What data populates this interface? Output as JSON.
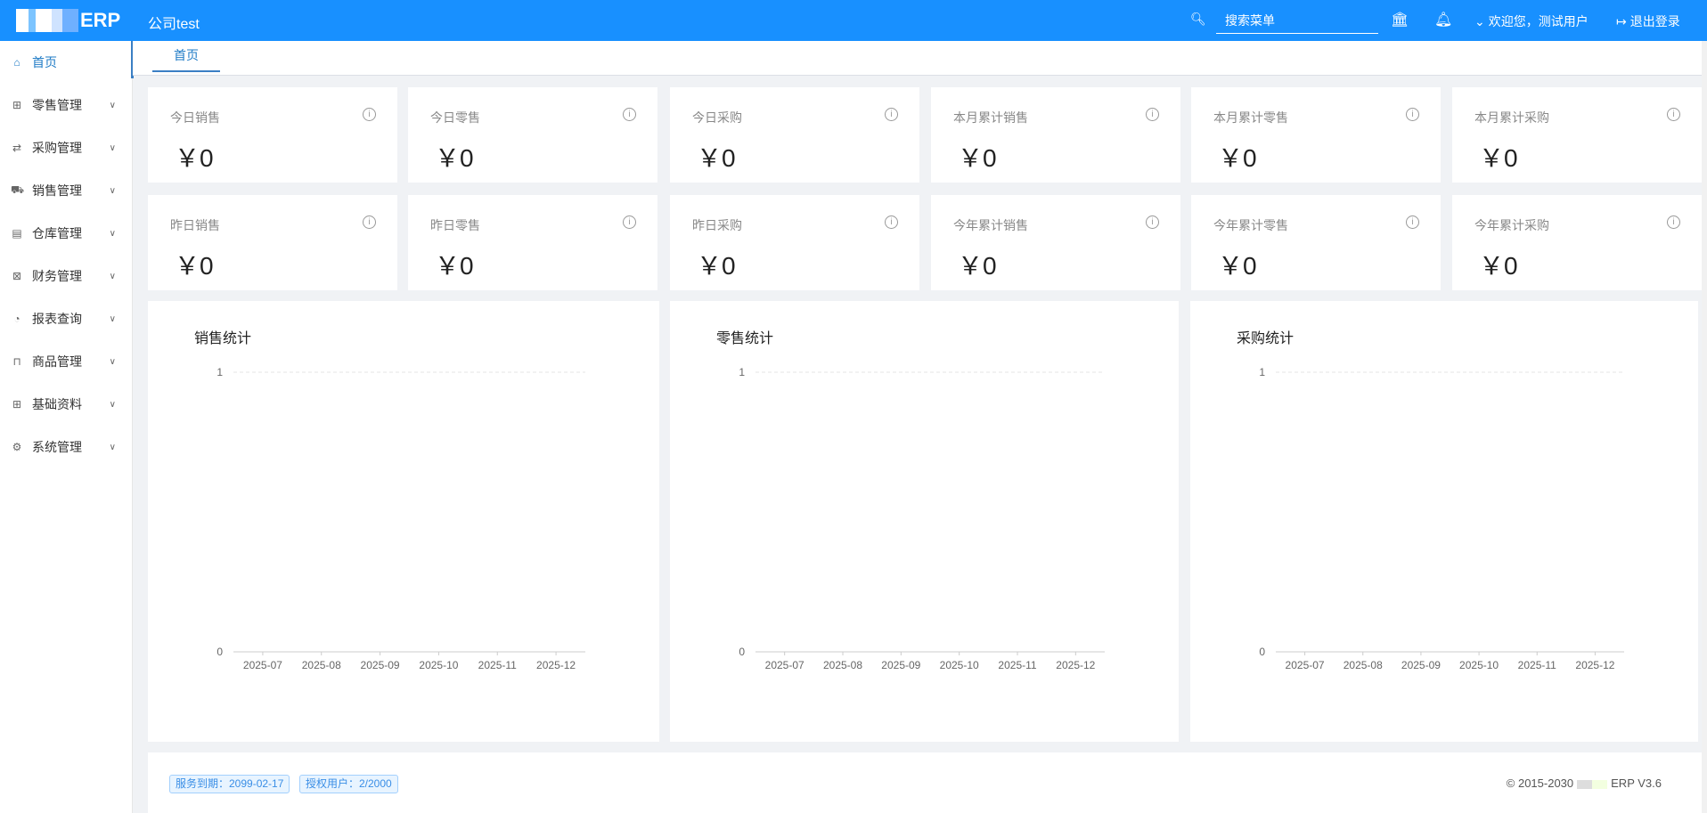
{
  "header": {
    "logo_text": "ERP",
    "company": "公司test",
    "search_placeholder": "搜索菜单",
    "welcome": "欢迎您，测试用户",
    "logout": "退出登录"
  },
  "sidebar": {
    "items": [
      {
        "label": "首页",
        "icon": "home-icon",
        "active": true
      },
      {
        "label": "零售管理",
        "icon": "gift-icon"
      },
      {
        "label": "采购管理",
        "icon": "swap-icon"
      },
      {
        "label": "销售管理",
        "icon": "cart-icon"
      },
      {
        "label": "仓库管理",
        "icon": "warehouse-icon"
      },
      {
        "label": "财务管理",
        "icon": "finance-icon"
      },
      {
        "label": "报表查询",
        "icon": "pie-chart-icon"
      },
      {
        "label": "商品管理",
        "icon": "bag-icon"
      },
      {
        "label": "基础资料",
        "icon": "grid-icon"
      },
      {
        "label": "系统管理",
        "icon": "gear-icon"
      }
    ]
  },
  "tabs": [
    {
      "label": "首页"
    }
  ],
  "stats": [
    {
      "title": "今日销售",
      "value": "￥0"
    },
    {
      "title": "今日零售",
      "value": "￥0"
    },
    {
      "title": "今日采购",
      "value": "￥0"
    },
    {
      "title": "本月累计销售",
      "value": "￥0"
    },
    {
      "title": "本月累计零售",
      "value": "￥0"
    },
    {
      "title": "本月累计采购",
      "value": "￥0"
    },
    {
      "title": "昨日销售",
      "value": "￥0"
    },
    {
      "title": "昨日零售",
      "value": "￥0"
    },
    {
      "title": "昨日采购",
      "value": "￥0"
    },
    {
      "title": "今年累计销售",
      "value": "￥0"
    },
    {
      "title": "今年累计零售",
      "value": "￥0"
    },
    {
      "title": "今年累计采购",
      "value": "￥0"
    }
  ],
  "chart_data": [
    {
      "type": "line",
      "title": "销售统计",
      "categories": [
        "2025-07",
        "2025-08",
        "2025-09",
        "2025-10",
        "2025-11",
        "2025-12"
      ],
      "series": [],
      "yticks": [
        "0",
        "1"
      ],
      "ylim": [
        0,
        1
      ],
      "grid": true
    },
    {
      "type": "line",
      "title": "零售统计",
      "categories": [
        "2025-07",
        "2025-08",
        "2025-09",
        "2025-10",
        "2025-11",
        "2025-12"
      ],
      "series": [],
      "yticks": [
        "0",
        "1"
      ],
      "ylim": [
        0,
        1
      ],
      "grid": true
    },
    {
      "type": "line",
      "title": "采购统计",
      "categories": [
        "2025-07",
        "2025-08",
        "2025-09",
        "2025-10",
        "2025-11",
        "2025-12"
      ],
      "series": [],
      "yticks": [
        "0",
        "1"
      ],
      "ylim": [
        0,
        1
      ],
      "grid": true
    }
  ],
  "footer": {
    "service_tag": "服务到期：2099-02-17",
    "users_tag": "授权用户：2/2000",
    "copyright": "© 2015-2030",
    "product": "ERP V3.6"
  }
}
